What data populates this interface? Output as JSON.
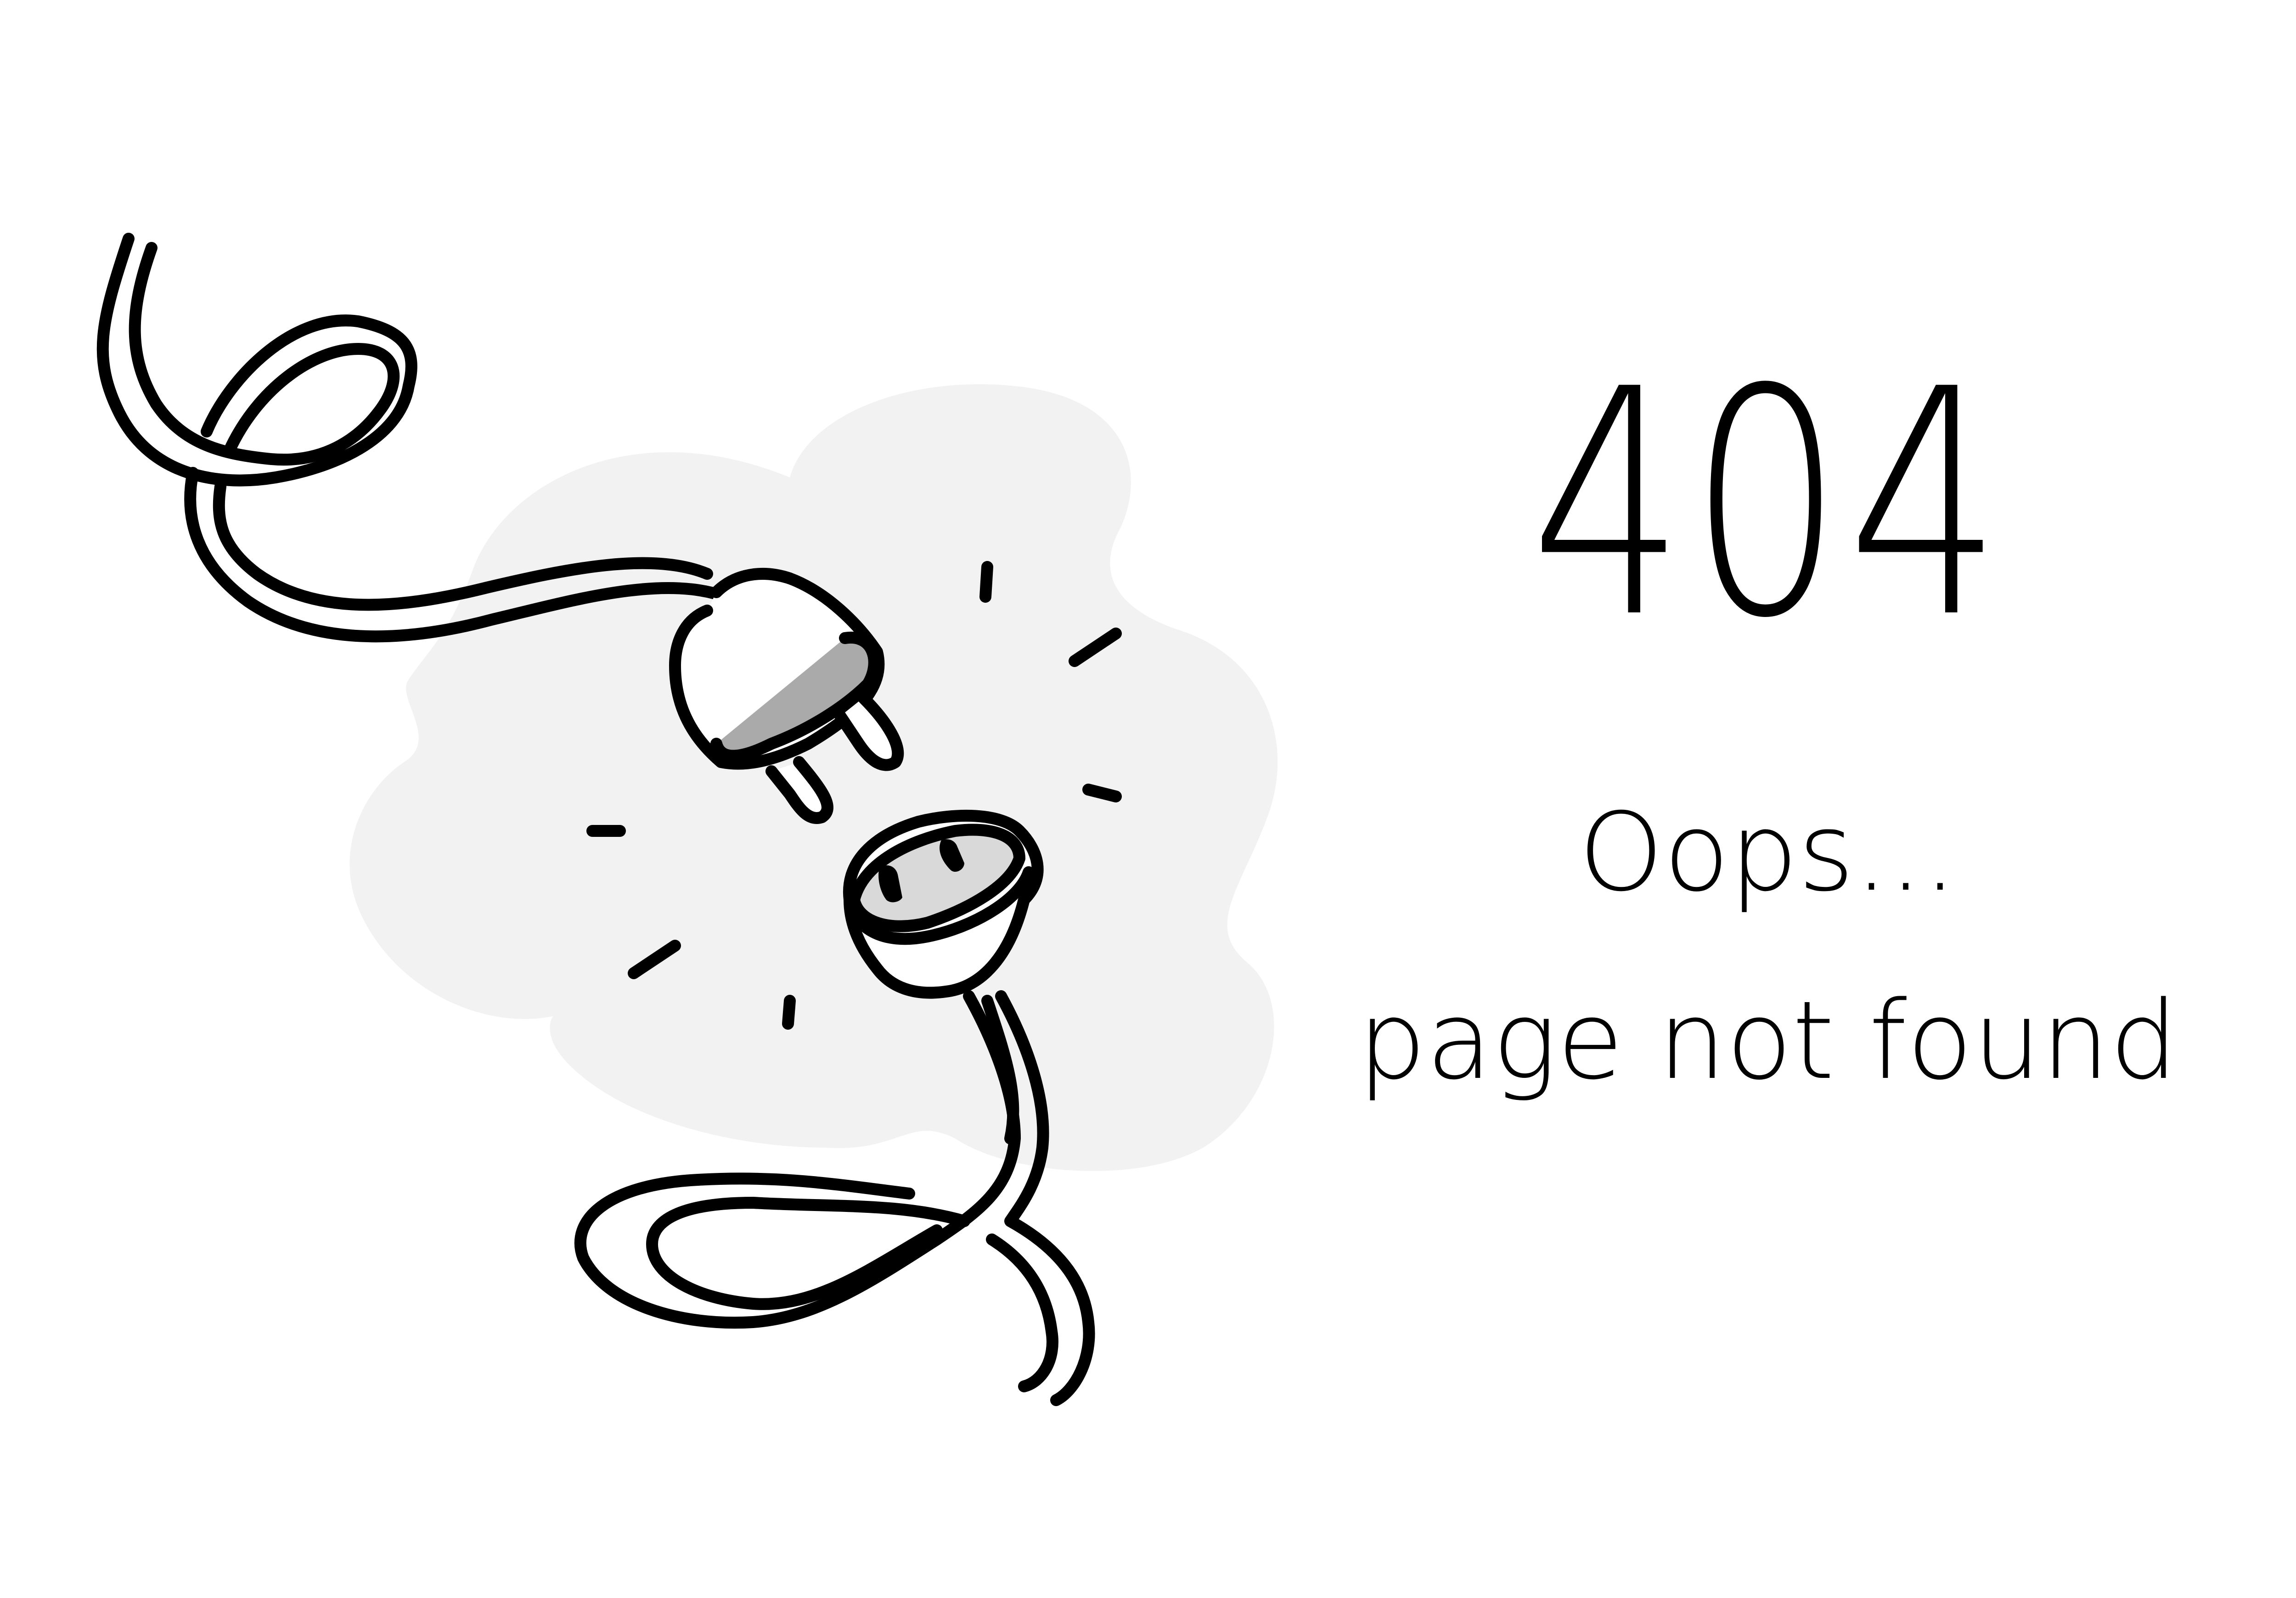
{
  "error": {
    "code": "404",
    "headline": "Oops...",
    "message": "page not found"
  },
  "illustration": {
    "subject": "unplugged-power-cord",
    "blob_color": "#f2f2f2",
    "line_color": "#000000",
    "plug_shade": "#aaaaaa",
    "socket_face": "#d9d9d9"
  }
}
